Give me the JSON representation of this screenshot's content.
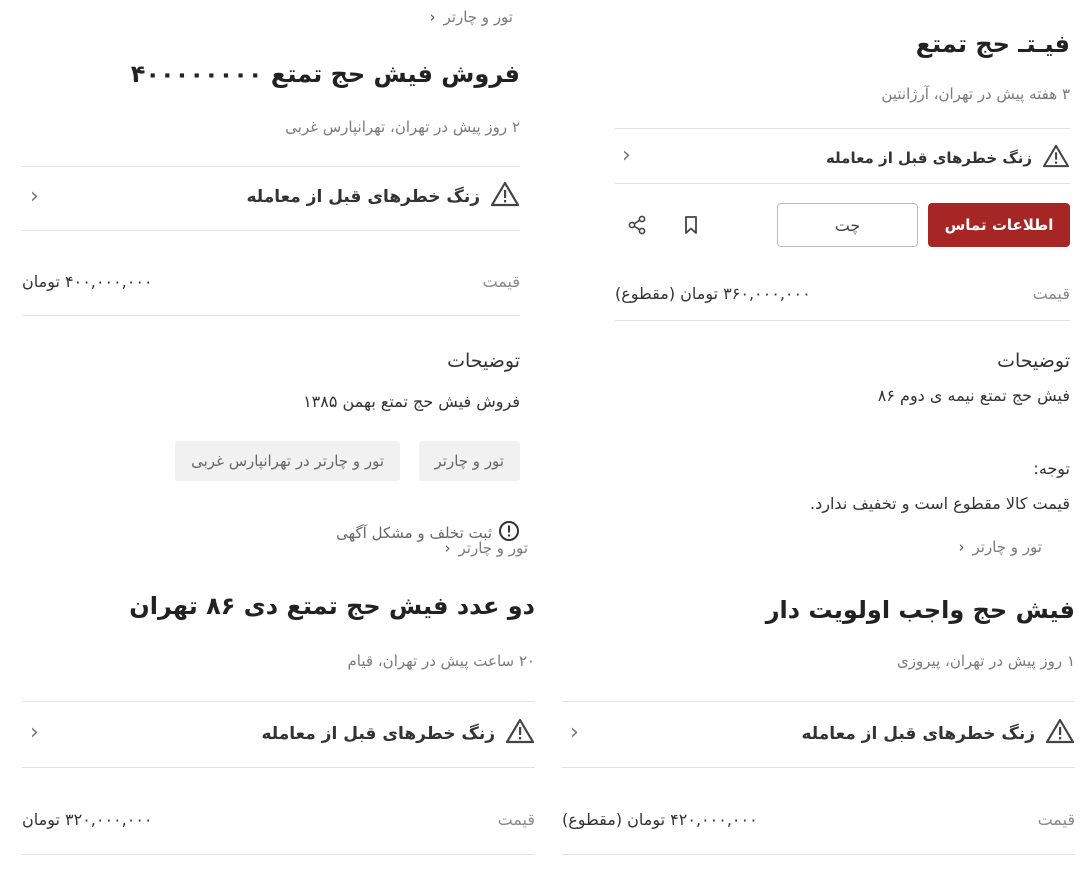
{
  "right_ad": {
    "title": "فیـتـ حج تمتع",
    "meta": "۳ هفته پیش در تهران، آرژانتین",
    "warning": "زنگ خطرهای قبل از معامله",
    "contact_button": "اطلاعات تماس",
    "chat_button": "چت",
    "bookmark_icon": "bookmark-icon",
    "share_icon": "share-icon",
    "price_label": "قیمت",
    "price_value": "۳۶۰,۰۰۰,۰۰۰ تومان (مقطوع)",
    "desc_title": "توضیحات",
    "desc_text": "فیش حج تمتع نیمه ی دوم ۸۶",
    "note_title": "توجه:",
    "note_text": "قیمت کالا مقطوع است و تخفیف ندارد."
  },
  "left_ad": {
    "breadcrumb": "تور و چارتر",
    "title": "فروش فیش حج تمتع ۴۰۰۰۰۰۰۰۰",
    "meta": "۲ روز پیش در تهران، تهرانپارس غربی",
    "warning": "زنگ خطرهای قبل از معامله",
    "price_label": "قیمت",
    "price_value": "۴۰۰,۰۰۰,۰۰۰ تومان",
    "desc_title": "توضیحات",
    "desc_text": "فروش فیش حج تمتع بهمن ۱۳۸۵",
    "tags": [
      "تور و چارتر",
      "تور و چارتر در تهرانپارس غربی"
    ],
    "report": "ثبت تخلف و مشکل آگهی"
  },
  "bottom_left_ad": {
    "breadcrumb": "تور و چارتر",
    "title": "دو عدد فیش حج تمتع دی ۸۶ تهران",
    "meta": "۲۰ ساعت پیش در تهران، قیام",
    "warning": "زنگ خطرهای قبل از معامله",
    "price_label": "قیمت",
    "price_value": "۳۲۰,۰۰۰,۰۰۰ تومان"
  },
  "bottom_right_ad": {
    "breadcrumb": "تور و چارتر",
    "title": "فیش حج واجب اولویت دار",
    "meta": "۱ روز پیش در تهران، پیروزی",
    "warning": "زنگ خطرهای قبل از معامله",
    "price_label": "قیمت",
    "price_value": "۴۲۰,۰۰۰,۰۰۰ تومان (مقطوع)"
  },
  "colors": {
    "primary": "#a62626",
    "divider": "#e2e2e2",
    "muted_text": "#7a7a7a",
    "chip_bg": "#f1f1f1"
  }
}
